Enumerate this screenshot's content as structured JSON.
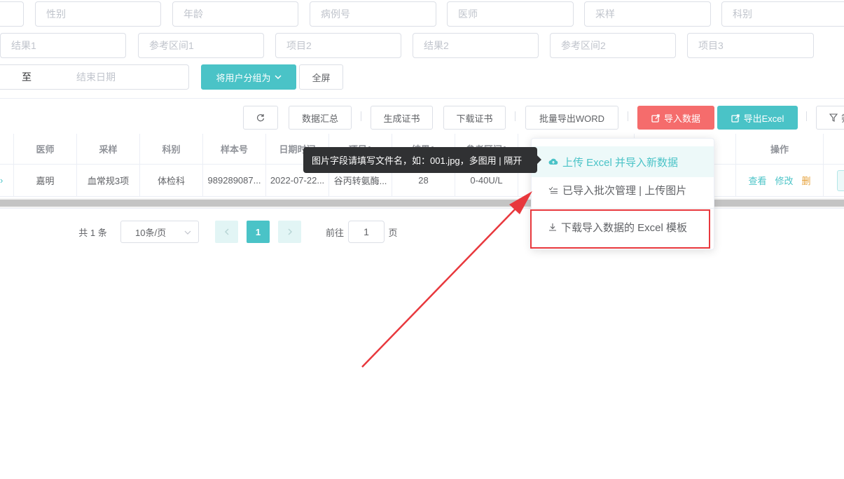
{
  "filters": {
    "row1": [
      "性别",
      "年龄",
      "病例号",
      "医师",
      "采样",
      "科别"
    ],
    "row2": [
      "结果1",
      "参考区间1",
      "项目2",
      "结果2",
      "参考区间2",
      "项目3"
    ],
    "date_separator": "至",
    "end_date_placeholder": "结束日期",
    "group_button": "将用户分组为",
    "fullscreen_button": "全屏"
  },
  "toolbar": {
    "summary": "数据汇总",
    "gen_cert": "生成证书",
    "download_cert": "下载证书",
    "batch_word": "批量导出WORD",
    "import_data": "导入数据",
    "export_excel": "导出Excel",
    "filter_partial": "筛"
  },
  "table": {
    "headers": [
      "医师",
      "采样",
      "科别",
      "样本号",
      "日期时间",
      "项目1",
      "结果1",
      "参考区间1",
      "",
      "",
      "操作"
    ],
    "row": {
      "doctor": "嘉明",
      "sample": "血常规3项",
      "dept": "体检科",
      "sample_no": "989289087...",
      "datetime": "2022-07-22...",
      "item1": "谷丙转氨酶...",
      "result1": "28",
      "ref1": "0-40U/L",
      "actions": [
        "查看",
        "修改",
        "删"
      ]
    }
  },
  "pagination": {
    "total": "共 1 条",
    "page_size": "10条/页",
    "current": "1",
    "goto_label": "前往",
    "goto_value": "1",
    "page_unit": "页"
  },
  "import_menu": {
    "items": [
      {
        "label": "上传 Excel 并导入新数据",
        "icon": "cloud-upload-icon"
      },
      {
        "label": "已导入批次管理 | 上传图片",
        "icon": "list-check-icon"
      },
      {
        "label": "下载导入数据的 Excel 模板",
        "icon": "download-icon"
      }
    ]
  },
  "tooltip": "图片字段请填写文件名，如：001.jpg，多图用 | 隔开",
  "colors": {
    "accent": "#4ac3c7",
    "danger": "#f56c6c",
    "annotation": "#e8383d",
    "warning": "#e6a23c"
  }
}
